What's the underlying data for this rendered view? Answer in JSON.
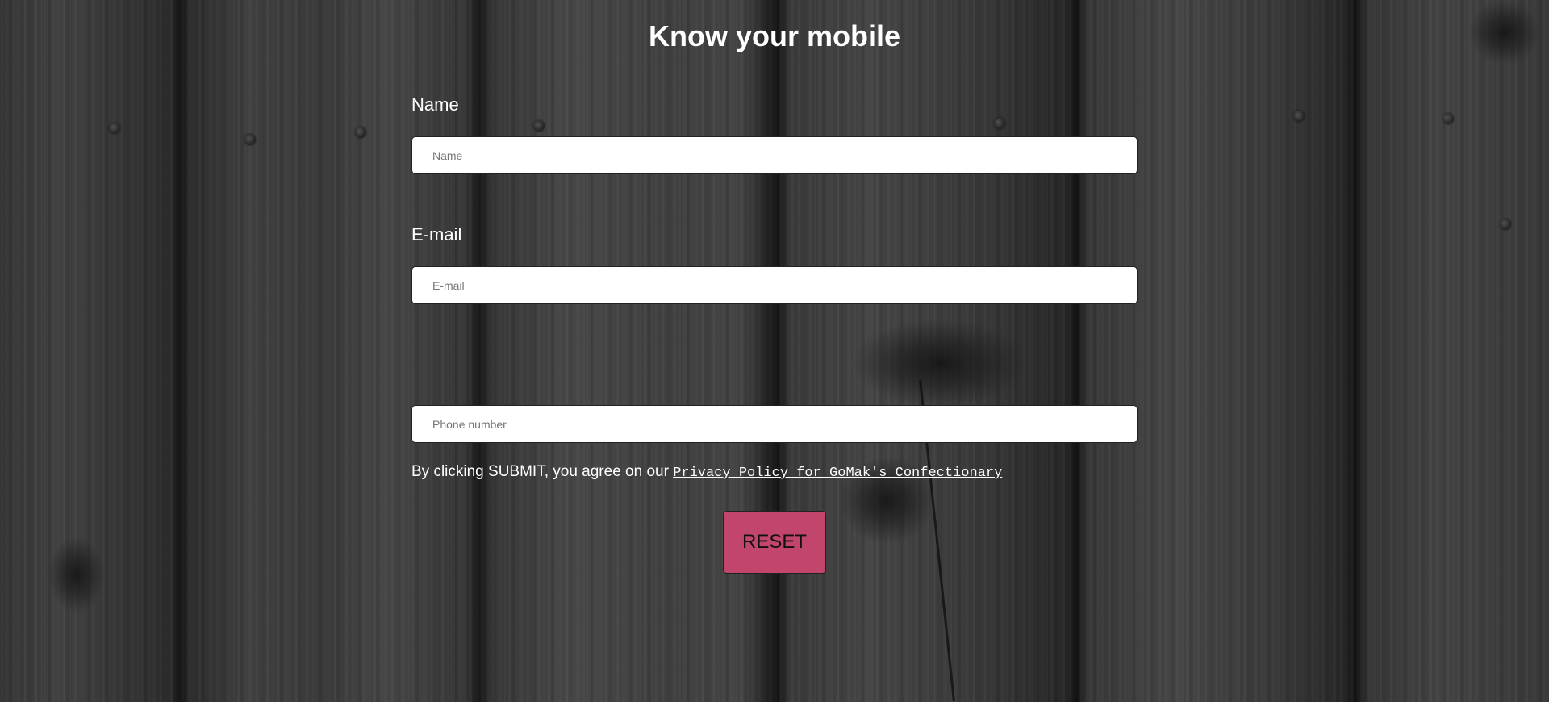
{
  "page": {
    "title": "Know your mobile"
  },
  "form": {
    "name": {
      "label": "Name",
      "placeholder": "Name",
      "value": ""
    },
    "email": {
      "label": "E-mail",
      "placeholder": "E-mail",
      "value": ""
    },
    "phone": {
      "placeholder": "Phone number",
      "value": ""
    },
    "agreement": {
      "text": "By clicking SUBMIT, you agree on our ",
      "link_text": "Privacy Policy for GoMak's Confectionary"
    },
    "reset_label": "RESET"
  },
  "colors": {
    "reset_button": "#c2456c",
    "heading_text": "#ffffff",
    "input_background": "#ffffff"
  }
}
